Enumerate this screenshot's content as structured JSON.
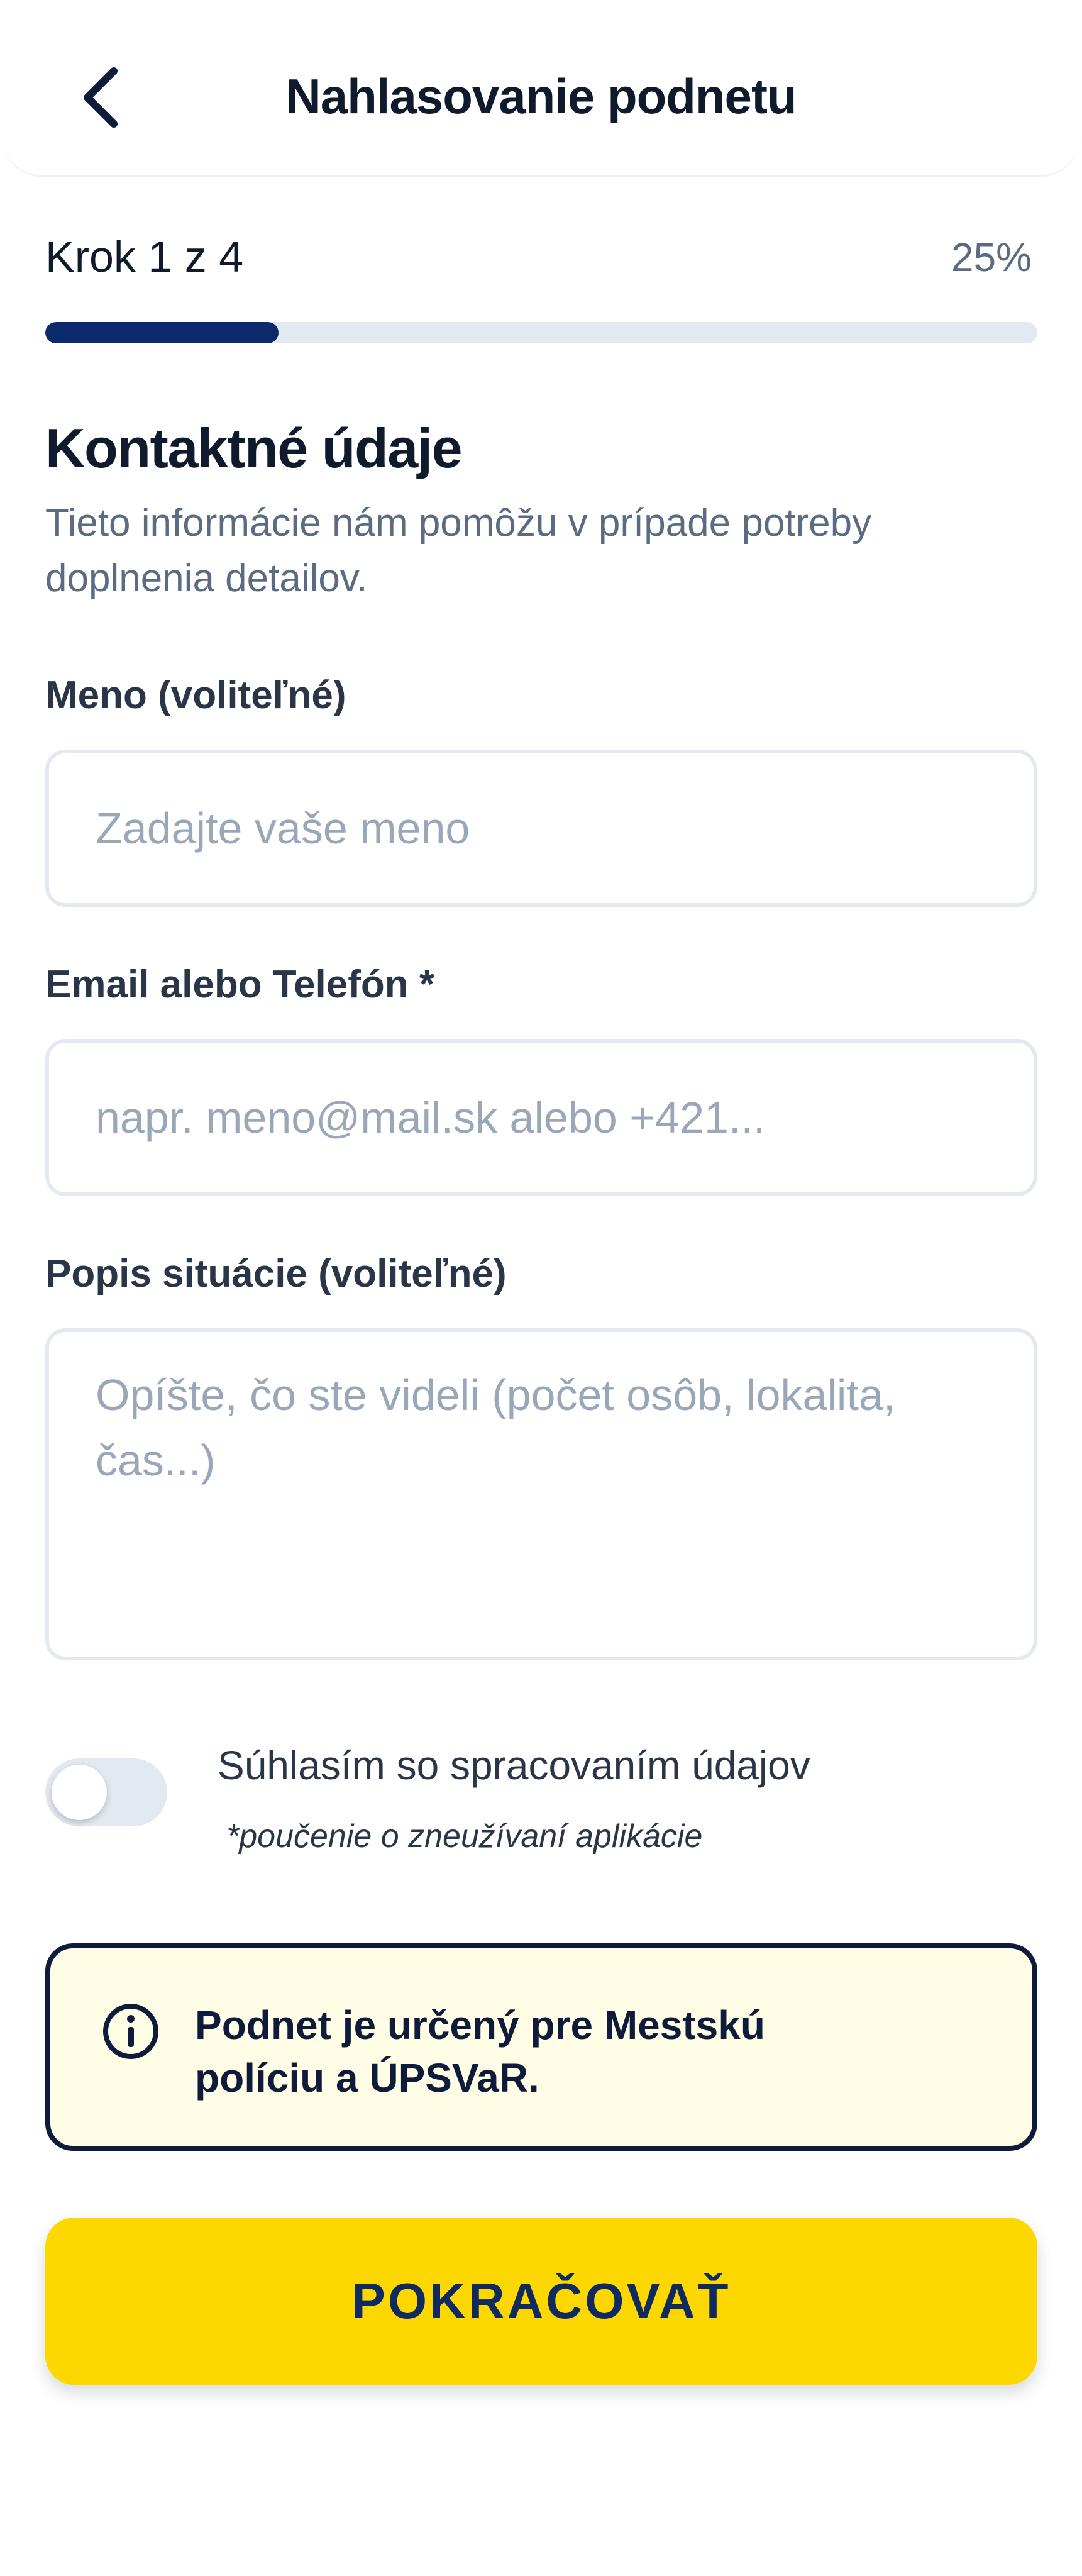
{
  "header": {
    "title": "Nahlasovanie podnetu",
    "back_icon": "chevron-left-icon"
  },
  "progress": {
    "step_label": "Krok 1 z 4",
    "percent_label": "25%",
    "fraction": 0.235
  },
  "section": {
    "title": "Kontaktné údaje",
    "description": "Tieto informácie nám pomôžu v prípade potreby doplnenia detailov."
  },
  "fields": {
    "name": {
      "label": "Meno (voliteľné)",
      "placeholder": "Zadajte vaše meno",
      "value": ""
    },
    "contact": {
      "label": "Email alebo Telefón *",
      "placeholder": "napr. meno@mail.sk alebo +421...",
      "value": ""
    },
    "description": {
      "label": "Popis situácie (voliteľné)",
      "placeholder": "Opíšte, čo ste videli (počet osôb, lokalita, čas...)",
      "value": ""
    }
  },
  "consent": {
    "label": "Súhlasím so spracovaním údajov",
    "note": "*poučenie o zneužívaní aplikácie",
    "checked": false
  },
  "info": {
    "icon": "info-circle-icon",
    "text": "Podnet je určený pre Mestskú políciu a ÚPSVaR."
  },
  "actions": {
    "continue_label": "POKRAČOVAŤ"
  },
  "colors": {
    "accent_yellow": "#fdd800",
    "navy": "#0a2a6b",
    "info_bg": "#fffde6",
    "track": "#e3e9f0"
  }
}
